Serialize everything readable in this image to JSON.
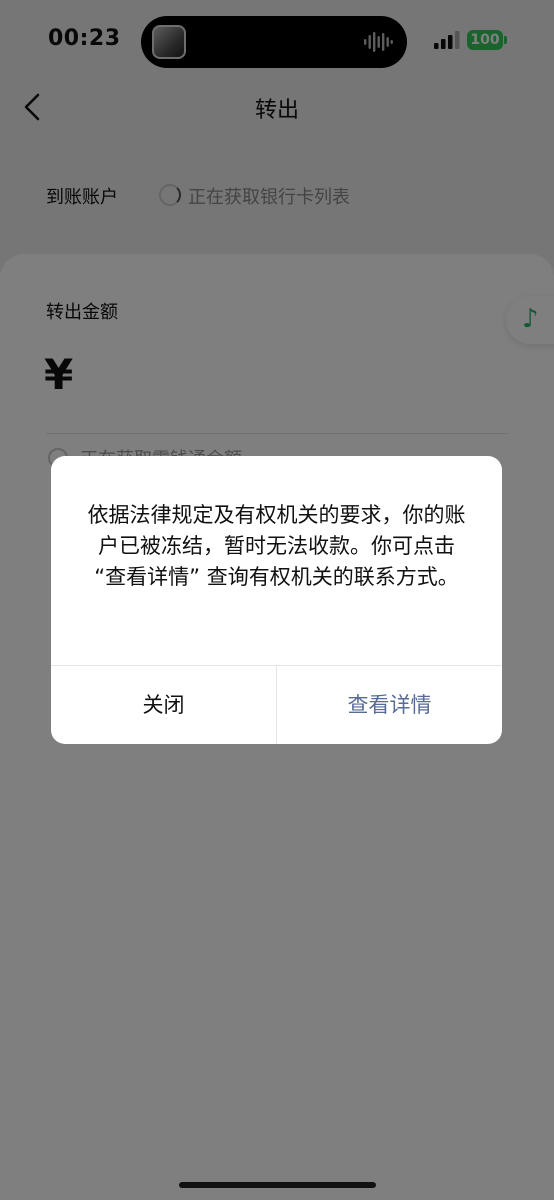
{
  "status_bar": {
    "time": "00:23",
    "battery": "100",
    "battery_color": "#34c759",
    "icons": [
      "island-album-thumbnail",
      "audio-waveform-icon",
      "signal-bars-icon",
      "battery-icon"
    ]
  },
  "nav": {
    "back_icon": "chevron-left-icon",
    "title": "转出"
  },
  "account": {
    "label": "到账账户",
    "loading_text": "正在获取银行卡列表"
  },
  "amount": {
    "label": "转出金额",
    "currency_symbol": "¥",
    "balance_loading_text": "正在获取零钱通余额"
  },
  "floating_music": {
    "icon": "music-note-icon",
    "color": "#2aae67"
  },
  "dialog": {
    "message": "依据法律规定及有权机关的要求，你的账户已被冻结，暂时无法收款。你可点击 “查看详情” 查询有权机关的联系方式。",
    "close_label": "关闭",
    "detail_label": "查看详情",
    "detail_color": "#576b95"
  }
}
